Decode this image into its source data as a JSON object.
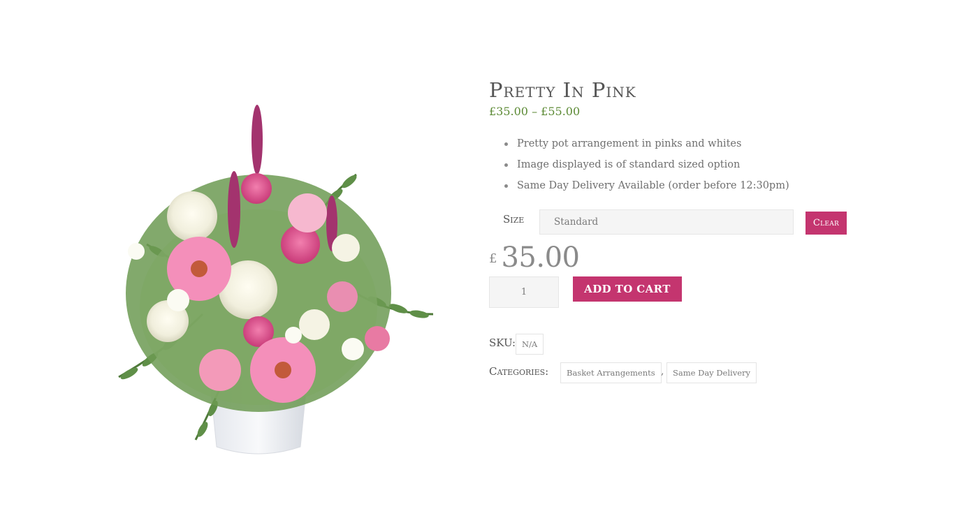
{
  "product": {
    "title": "Pretty In Pink",
    "price_range": "£35.00 – £55.00",
    "features": [
      "Pretty pot arrangement in pinks and whites",
      "Image displayed is of standard sized option",
      "Same Day Delivery Available (order before 12:30pm)"
    ],
    "image_alt": "Pink and white flower pot arrangement"
  },
  "variation": {
    "size_label": "Size",
    "size_selected": "Standard",
    "clear_label": "Clear",
    "currency_symbol": "£",
    "price": "35.00"
  },
  "cart": {
    "quantity": "1",
    "add_to_cart_label": "ADD TO CART"
  },
  "meta": {
    "sku_label": "SKU:",
    "sku_value": "N/A",
    "categories_label": "Categories:",
    "categories": [
      "Basket Arrangements",
      "Same Day Delivery"
    ],
    "separator": ","
  },
  "colors": {
    "accent": "#c4356f",
    "price_green": "#5c8a35",
    "input_bg": "#f5f5f5"
  }
}
